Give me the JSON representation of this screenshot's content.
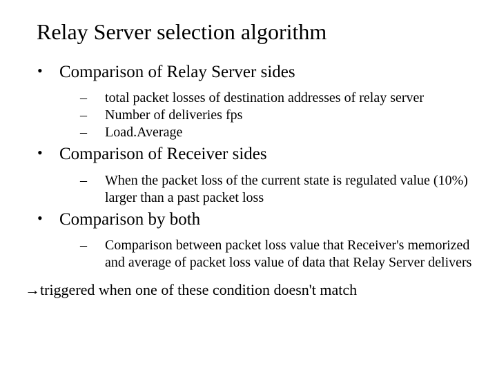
{
  "title": "Relay Server selection algorithm",
  "sections": [
    {
      "heading": "Comparison of Relay Server sides",
      "items": [
        "total packet losses of destination addresses of relay server",
        "Number of deliveries fps",
        "Load.Average"
      ]
    },
    {
      "heading": "Comparison of Receiver sides",
      "items": [
        "When the packet loss of the current state is regulated value (10%) larger than a past packet loss"
      ]
    },
    {
      "heading": "Comparison by both",
      "items": [
        "Comparison between packet loss value that Receiver's memorized and average of packet loss value of data that Relay Server delivers"
      ]
    }
  ],
  "footer": "→triggered when one of these condition doesn't match",
  "bullets": {
    "level1": "•",
    "level2": "–"
  }
}
